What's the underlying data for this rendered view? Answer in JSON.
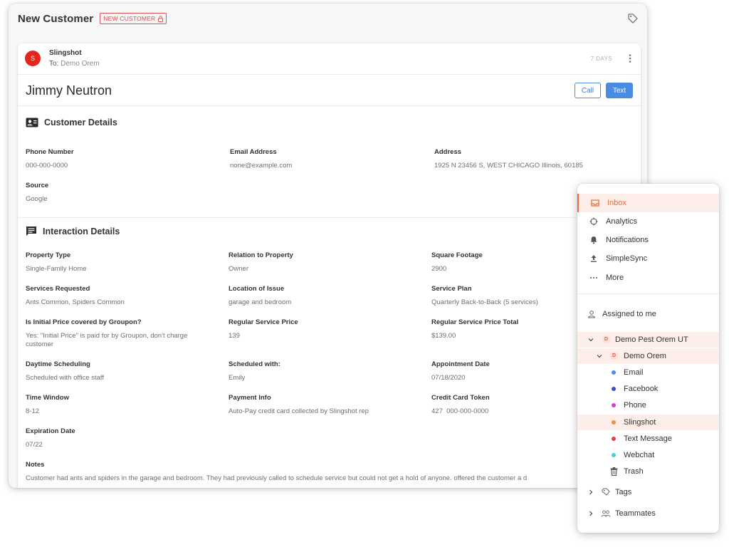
{
  "header": {
    "title": "New Customer",
    "badge": "NEW CUSTOMER"
  },
  "conversation": {
    "avatar_initial": "S",
    "sender": "Slingshot",
    "to_label": "To:",
    "to_value": "Demo Orem",
    "time_ago": "7 DAYS"
  },
  "contact": {
    "name": "Jimmy Neutron",
    "call_label": "Call",
    "text_label": "Text"
  },
  "customer_details": {
    "title": "Customer Details",
    "fields": [
      {
        "label": "Phone Number",
        "value": "000-000-0000"
      },
      {
        "label": "Email Address",
        "value": "none@example.com"
      },
      {
        "label": "Address",
        "value": "1925 N 23456 S, WEST CHICAGO Illinois, 60185"
      },
      {
        "label": "Source",
        "value": "Google"
      }
    ]
  },
  "interaction_details": {
    "title": "Interaction Details",
    "fields": [
      {
        "label": "Property Type",
        "value": "Single-Family Home"
      },
      {
        "label": "Relation to Property",
        "value": "Owner"
      },
      {
        "label": "Square Footage",
        "value": "2900"
      },
      {
        "label": "Services Requested",
        "value": "Ants Common, Spiders Common"
      },
      {
        "label": "Location of Issue",
        "value": "garage and bedroom"
      },
      {
        "label": "Service Plan",
        "value": "Quarterly Back-to-Back (5 services)"
      },
      {
        "label": "Is Initial Price covered by Groupon?",
        "value": "Yes: \"Initial Price\" is paid for by Groupon, don't charge customer"
      },
      {
        "label": "Regular Service Price",
        "value": "139"
      },
      {
        "label": "Regular Service Price Total",
        "value": "$139.00"
      },
      {
        "label": "Daytime Scheduling",
        "value": "Scheduled with office staff"
      },
      {
        "label": "Scheduled with:",
        "value": "Emily"
      },
      {
        "label": "Appointment Date",
        "value": "07/18/2020"
      },
      {
        "label": "Time Window",
        "value": "8-12"
      },
      {
        "label": "Payment Info",
        "value": "Auto-Pay credit card collected by Slingshot rep"
      },
      {
        "label": "Credit Card Token",
        "value": "427  000-000-0000"
      },
      {
        "label": "Expiration Date",
        "value": "07/22"
      },
      {
        "label": "Notes",
        "value": "Customer had ants and spiders in the garage and bedroom. They had previously called to schedule service but could not get a hold of anyone. offered the customer a d"
      }
    ]
  },
  "sidebar": {
    "nav": [
      {
        "label": "Inbox",
        "icon": "inbox-icon",
        "active": true
      },
      {
        "label": "Analytics",
        "icon": "analytics-icon"
      },
      {
        "label": "Notifications",
        "icon": "bell-icon"
      },
      {
        "label": "SimpleSync",
        "icon": "upload-icon"
      },
      {
        "label": "More",
        "icon": "more-horizontal-icon"
      }
    ],
    "assigned": "Assigned to me",
    "org": {
      "initial": "D",
      "name": "Demo Pest Orem UT"
    },
    "location": {
      "initial": "D",
      "name": "Demo Orem"
    },
    "channels": [
      {
        "label": "Email",
        "color": "#4a90e2"
      },
      {
        "label": "Facebook",
        "color": "#3b4fc4"
      },
      {
        "label": "Phone",
        "color": "#d23fd2"
      },
      {
        "label": "Slingshot",
        "color": "#e8924a"
      },
      {
        "label": "Text Message",
        "color": "#e04040"
      },
      {
        "label": "Webchat",
        "color": "#3fd4d4"
      }
    ],
    "trash": "Trash",
    "tags": "Tags",
    "teammates": "Teammates"
  }
}
